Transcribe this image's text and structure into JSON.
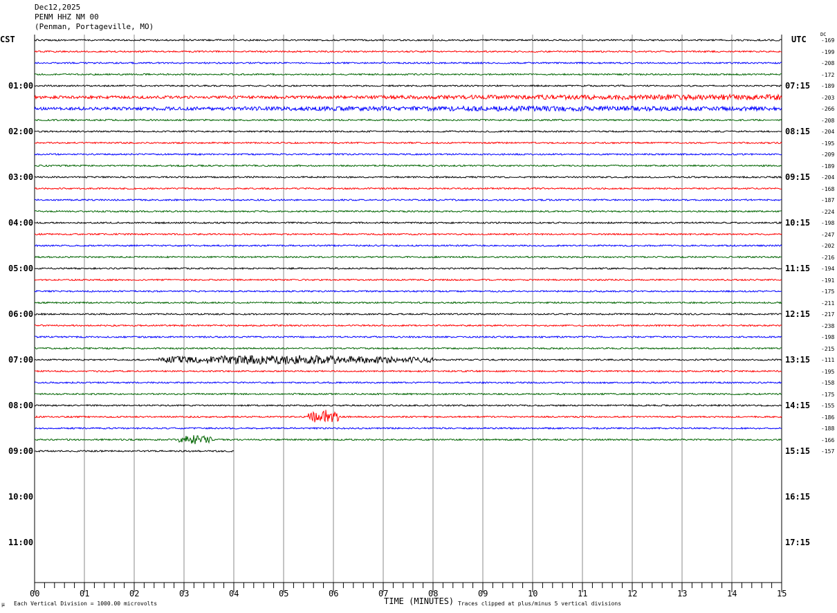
{
  "header": {
    "date": "Dec12,2025",
    "station": "PENM HHZ NM 00",
    "location": "(Penman, Portageville, MO)"
  },
  "left_zone": "CST",
  "right_zone": "UTC",
  "dc_label": "DC",
  "footer": {
    "scale": "Each Vertical Division = 1000.00 microvolts",
    "clip": "Traces clipped at plus/minus 5 vertical divisions",
    "mark": "µ"
  },
  "colors": [
    "#000000",
    "#ff0000",
    "#0000ff",
    "#006400"
  ],
  "chart_data": {
    "type": "line",
    "title": "PENM HHZ NM 00 helicorder",
    "xlabel": "TIME (MINUTES)",
    "x_ticks": [
      "00",
      "01",
      "02",
      "03",
      "04",
      "05",
      "06",
      "07",
      "08",
      "09",
      "10",
      "11",
      "12",
      "13",
      "14",
      "15"
    ],
    "xlim": [
      0,
      15
    ],
    "trace_minutes": 15,
    "total_rows": 48,
    "rows_drawn": 37,
    "last_row_end_minute": 4,
    "left_hour_labels": [
      "01:00",
      "02:00",
      "03:00",
      "04:00",
      "05:00",
      "06:00",
      "07:00",
      "08:00",
      "09:00",
      "10:00",
      "11:00"
    ],
    "right_hour_labels": [
      "07:15",
      "08:15",
      "09:15",
      "10:15",
      "11:15",
      "12:15",
      "13:15",
      "14:15",
      "15:15",
      "16:15",
      "17:15"
    ],
    "dc_offsets": [
      "-169",
      "-199",
      "-208",
      "-172",
      "-189",
      "-203",
      "-266",
      "-208",
      "-204",
      "-195",
      "-209",
      "-189",
      "-204",
      "-168",
      "-187",
      "-224",
      "-198",
      "-247",
      "-202",
      "-216",
      "-194",
      "-191",
      "-175",
      "-211",
      "-217",
      "-238",
      "-198",
      "-215",
      "-111",
      "-195",
      "-158",
      "-175",
      "-155",
      "-186",
      "-188",
      "-166",
      "-157"
    ],
    "events": [
      {
        "row": 28,
        "start_min": 2.5,
        "end_min": 8,
        "peak_min": 5,
        "amplitude": 3
      },
      {
        "row": 33,
        "start_min": 5.5,
        "end_min": 6.1,
        "peak_min": 5.8,
        "amplitude": 5
      },
      {
        "row": 35,
        "start_min": 2.9,
        "end_min": 3.6,
        "peak_min": 3.2,
        "amplitude": 3
      },
      {
        "row": 5,
        "start_min": 0,
        "end_min": 15,
        "peak_min": 14.9,
        "amplitude": 1.5
      },
      {
        "row": 6,
        "start_min": 0,
        "end_min": 15,
        "peak_min": 10,
        "amplitude": 1.3
      }
    ]
  }
}
